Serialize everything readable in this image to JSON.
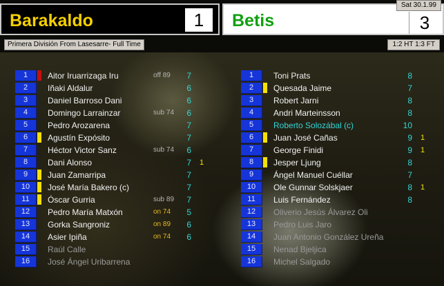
{
  "home_team": {
    "name": "Barakaldo",
    "score": "1"
  },
  "away_team": {
    "name": "Betis",
    "score": "3"
  },
  "date": "Sat 30.1.99",
  "competition_info": "Primera División From Lasesarre- Full Time",
  "halftime_fulltime": "1:2 HT 1:3 FT",
  "colors": {
    "home_name": "#f7d000",
    "away_name": "#10a010",
    "number_badge": "#1535d9",
    "yellow_card": "#f5e000",
    "red_card": "#c41010",
    "rating": "#33d6d6"
  },
  "home_players": [
    {
      "num": "1",
      "name": "Aitor Iruarrizaga Iru",
      "note": "off 89",
      "rating": "7",
      "goals": "",
      "card": "red",
      "style": ""
    },
    {
      "num": "2",
      "name": "Iñaki Aldalur",
      "note": "",
      "rating": "6",
      "goals": "",
      "card": "",
      "style": ""
    },
    {
      "num": "3",
      "name": "Daniel Barroso Dani",
      "note": "",
      "rating": "6",
      "goals": "",
      "card": "",
      "style": ""
    },
    {
      "num": "4",
      "name": "Domingo Larrainzar",
      "note": "sub 74",
      "rating": "6",
      "goals": "",
      "card": "",
      "style": ""
    },
    {
      "num": "5",
      "name": "Pedro Arozarena",
      "note": "",
      "rating": "7",
      "goals": "",
      "card": "",
      "style": ""
    },
    {
      "num": "6",
      "name": "Agustín Expósito",
      "note": "",
      "rating": "7",
      "goals": "",
      "card": "yellow",
      "style": ""
    },
    {
      "num": "7",
      "name": "Héctor Victor Sanz",
      "note": "sub 74",
      "rating": "6",
      "goals": "",
      "card": "",
      "style": ""
    },
    {
      "num": "8",
      "name": "Dani Alonso",
      "note": "",
      "rating": "7",
      "goals": "1",
      "card": "",
      "style": ""
    },
    {
      "num": "9",
      "name": "Juan Zamarripa",
      "note": "",
      "rating": "7",
      "goals": "",
      "card": "yellow",
      "style": ""
    },
    {
      "num": "10",
      "name": "José María Bakero (c)",
      "note": "",
      "rating": "7",
      "goals": "",
      "card": "yellow",
      "style": ""
    },
    {
      "num": "11",
      "name": "Óscar Gurria",
      "note": "sub 89",
      "rating": "7",
      "goals": "",
      "card": "yellow",
      "style": ""
    },
    {
      "num": "12",
      "name": "Pedro María Matxón",
      "note": "on 74",
      "rating": "5",
      "goals": "",
      "card": "",
      "style": "",
      "note_on": true
    },
    {
      "num": "13",
      "name": "Gorka Sangroniz",
      "note": "on 89",
      "rating": "6",
      "goals": "",
      "card": "",
      "style": "",
      "note_on": true
    },
    {
      "num": "14",
      "name": "Asier Ipiña",
      "note": "on 74",
      "rating": "6",
      "goals": "",
      "card": "",
      "style": "",
      "note_on": true
    },
    {
      "num": "15",
      "name": "Raúl Calle",
      "note": "",
      "rating": "",
      "goals": "",
      "card": "",
      "style": "sub"
    },
    {
      "num": "16",
      "name": "José Ángel Uribarrena",
      "note": "",
      "rating": "",
      "goals": "",
      "card": "",
      "style": "sub"
    }
  ],
  "away_players": [
    {
      "num": "1",
      "name": "Toni Prats",
      "rating": "8",
      "goals": "",
      "card": "",
      "style": ""
    },
    {
      "num": "2",
      "name": "Quesada Jaime",
      "rating": "7",
      "goals": "",
      "card": "yellow",
      "style": ""
    },
    {
      "num": "3",
      "name": "Robert Jarni",
      "rating": "8",
      "goals": "",
      "card": "",
      "style": ""
    },
    {
      "num": "4",
      "name": "Andri Marteinsson",
      "rating": "8",
      "goals": "",
      "card": "",
      "style": ""
    },
    {
      "num": "5",
      "name": "Roberto Solozábal (c)",
      "rating": "10",
      "goals": "",
      "card": "",
      "style": "star"
    },
    {
      "num": "6",
      "name": "Juan José Cañas",
      "rating": "9",
      "goals": "1",
      "card": "yellow",
      "style": ""
    },
    {
      "num": "7",
      "name": "George Finidi",
      "rating": "9",
      "goals": "1",
      "card": "",
      "style": ""
    },
    {
      "num": "8",
      "name": "Jesper Ljung",
      "rating": "8",
      "goals": "",
      "card": "yellow",
      "style": ""
    },
    {
      "num": "9",
      "name": "Ángel Manuel Cuéllar",
      "rating": "7",
      "goals": "",
      "card": "",
      "style": ""
    },
    {
      "num": "10",
      "name": "Ole Gunnar Solskjaer",
      "rating": "8",
      "goals": "1",
      "card": "",
      "style": ""
    },
    {
      "num": "11",
      "name": "Luis Fernández",
      "rating": "8",
      "goals": "",
      "card": "",
      "style": ""
    },
    {
      "num": "12",
      "name": "Oliverio Jesús Álvarez Oli",
      "rating": "",
      "goals": "",
      "card": "",
      "style": "sub"
    },
    {
      "num": "13",
      "name": "Pedro Luis Jaro",
      "rating": "",
      "goals": "",
      "card": "",
      "style": "sub"
    },
    {
      "num": "14",
      "name": "Juan Antonio González Ureña",
      "rating": "",
      "goals": "",
      "card": "",
      "style": "sub"
    },
    {
      "num": "15",
      "name": "Nenad Bjeljica",
      "rating": "",
      "goals": "",
      "card": "",
      "style": "sub"
    },
    {
      "num": "16",
      "name": "Michel Salgado",
      "rating": "",
      "goals": "",
      "card": "",
      "style": "sub"
    }
  ]
}
